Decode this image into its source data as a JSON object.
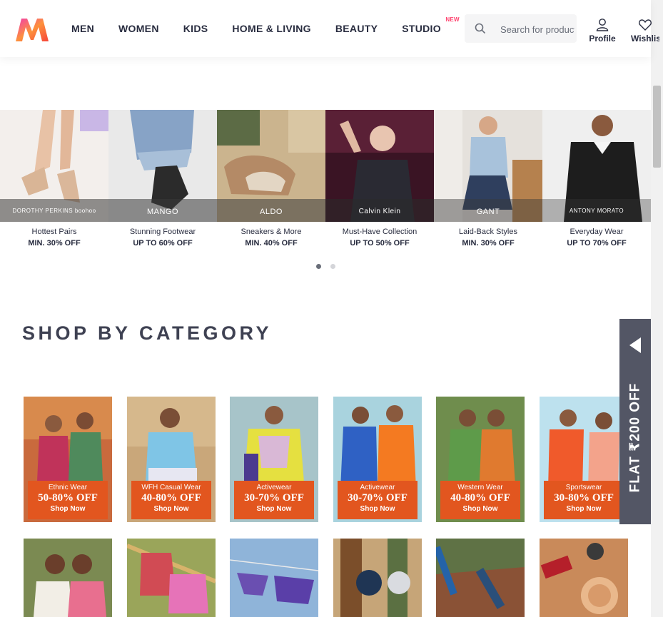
{
  "header": {
    "nav": [
      {
        "label": "MEN"
      },
      {
        "label": "WOMEN"
      },
      {
        "label": "KIDS"
      },
      {
        "label": "HOME & LIVING"
      },
      {
        "label": "BEAUTY"
      },
      {
        "label": "STUDIO",
        "tag": "NEW"
      }
    ],
    "search_placeholder": "Search for products, brands and more",
    "profile_label": "Profile",
    "wishlist_label": "Wishlist"
  },
  "carousel": {
    "items": [
      {
        "brand": "DOROTHY PERKINS  boohoo",
        "caption": "Hottest Pairs",
        "offer": "MIN. 30% OFF"
      },
      {
        "brand": "MANGO",
        "caption": "Stunning Footwear",
        "offer": "UP TO 60% OFF"
      },
      {
        "brand": "ALDO",
        "caption": "Sneakers & More",
        "offer": "MIN. 40% OFF"
      },
      {
        "brand": "Calvin Klein",
        "caption": "Must-Have Collection",
        "offer": "UP TO 50% OFF"
      },
      {
        "brand": "GANT",
        "caption": "Laid-Back Styles",
        "offer": "MIN. 30% OFF"
      },
      {
        "brand": "ANTONY MORATO",
        "caption": "Everyday Wear",
        "offer": "UP TO 70% OFF"
      }
    ],
    "active_page": 1,
    "page_count": 2
  },
  "section_title": "SHOP BY CATEGORY",
  "flat_offer": "FLAT ₹200 OFF",
  "categories": [
    {
      "name": "Ethnic Wear",
      "discount": "50-80% OFF",
      "cta": "Shop Now"
    },
    {
      "name": "WFH Casual Wear",
      "discount": "40-80% OFF",
      "cta": "Shop Now"
    },
    {
      "name": "Activewear",
      "discount": "30-70% OFF",
      "cta": "Shop Now"
    },
    {
      "name": "Activewear",
      "discount": "30-70% OFF",
      "cta": "Shop Now"
    },
    {
      "name": "Western Wear",
      "discount": "40-80% OFF",
      "cta": "Shop Now"
    },
    {
      "name": "Sportswear",
      "discount": "30-80% OFF",
      "cta": "Shop Now"
    }
  ],
  "colors": {
    "accent": "#ff3f6c",
    "text": "#282c3f",
    "title": "#3e4152",
    "offer_tab": "#535665",
    "banner": "#e2561f"
  }
}
